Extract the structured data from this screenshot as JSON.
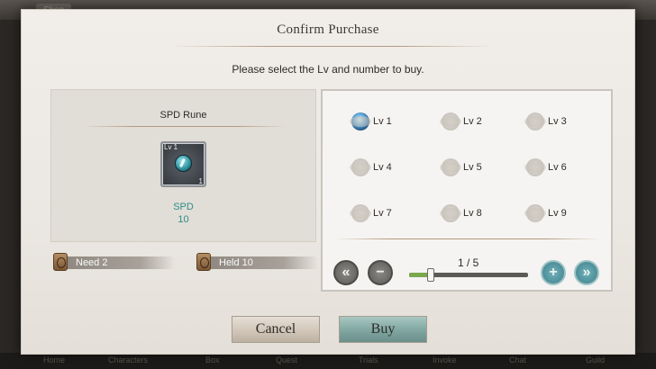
{
  "background": {
    "top_tab": "Shop",
    "nav_items": [
      "Home",
      "Characters",
      "Box",
      "Quest",
      "Trials",
      "Invoke",
      "Chat",
      "Guild"
    ]
  },
  "dialog": {
    "title": "Confirm Purchase",
    "subtitle": "Please select the Lv and number to buy."
  },
  "item": {
    "name": "SPD Rune",
    "icon_level": "Lv 1",
    "icon_count": "1",
    "icon": "rune-gem-icon",
    "stat_name": "SPD",
    "stat_value": "10"
  },
  "need": "Need 2",
  "held": "Held  10",
  "levels": [
    {
      "label": "Lv 1",
      "selected": true
    },
    {
      "label": "Lv 2",
      "selected": false
    },
    {
      "label": "Lv 3",
      "selected": false
    },
    {
      "label": "Lv 4",
      "selected": false
    },
    {
      "label": "Lv 5",
      "selected": false
    },
    {
      "label": "Lv 6",
      "selected": false
    },
    {
      "label": "Lv 7",
      "selected": false
    },
    {
      "label": "Lv 8",
      "selected": false
    },
    {
      "label": "Lv 9",
      "selected": false
    }
  ],
  "quantity": {
    "text": "1 / 5",
    "current": 1,
    "max": 5
  },
  "buttons": {
    "cancel": "Cancel",
    "buy": "Buy"
  },
  "colors": {
    "stat_text": "#2d8f88",
    "buy_button": "#7fa6a0",
    "slider_fill": "#7aa84b"
  }
}
